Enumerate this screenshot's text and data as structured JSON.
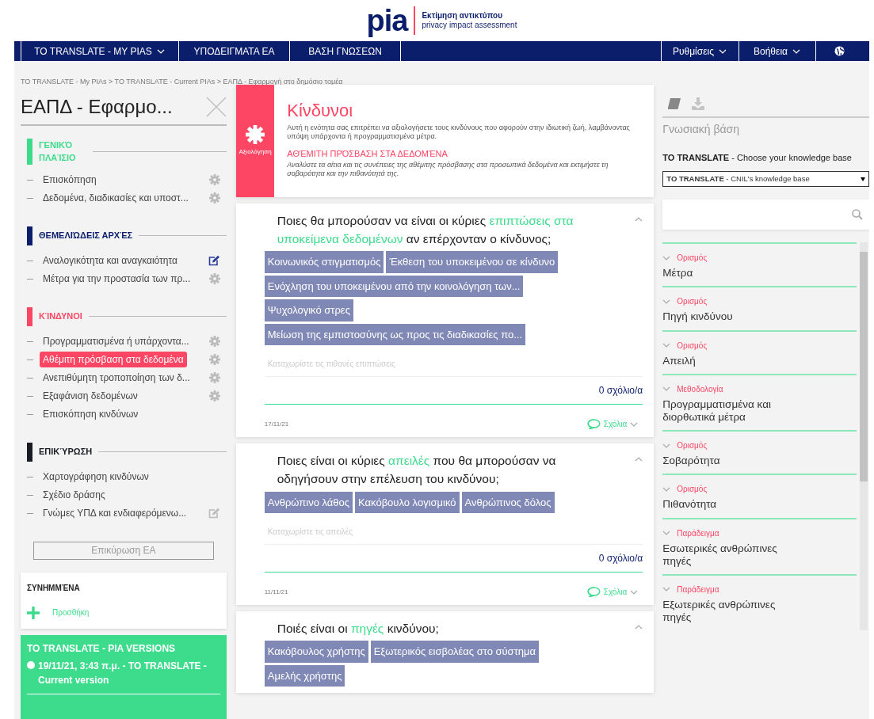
{
  "header": {
    "logo_mark": "pia",
    "logo_line1": "Εκτίμηση αντικτύπου",
    "logo_line2": "privacy impact assessment"
  },
  "nav": {
    "left": [
      {
        "label": "TO TRANSLATE - MY PIAS",
        "dropdown": true
      },
      {
        "label": "ΥΠΟΔΕΙΓΜΑΤΑ ΕΑ",
        "dropdown": false
      },
      {
        "label": "ΒΑΣΗ ΓΝΩΣΕΩΝ",
        "dropdown": false
      }
    ],
    "right": [
      {
        "label": "Ρυθμίσεις",
        "dropdown": true
      },
      {
        "label": "Βοήθεια",
        "dropdown": true
      }
    ]
  },
  "breadcrumb": "TO TRANSLATE - My PIAs > TO TRANSLATE - Current PIAs > ΕΑΠΔ - Εφαρμογή στο δημόσιο τομέα",
  "sidebar": {
    "title": "ΕΑΠΔ - Εφαρμο...",
    "sections": [
      {
        "title": "ΓΕΝΙΚΌ ΠΛΑΊΣΙΟ",
        "color": "#3ddc8c",
        "items": [
          {
            "label": "Επισκόπηση",
            "kind": "settings",
            "selected": false
          },
          {
            "label": "Δεδομένα, διαδικασίες και υποστ...",
            "kind": "settings",
            "selected": false
          }
        ]
      },
      {
        "title": "ΘΕΜΕΛΙΏΔΕΙΣ ΑΡΧΈΣ",
        "color": "#0b1e6b",
        "items": [
          {
            "label": "Αναλογικότητα και αναγκαιότητα",
            "kind": "edit",
            "active": true,
            "selected": false
          },
          {
            "label": "Μέτρα για την προστασία των πρ...",
            "kind": "settings",
            "selected": false
          }
        ]
      },
      {
        "title": "ΚΊΝΔΥΝΟΙ",
        "color": "#fd4664",
        "items": [
          {
            "label": "Προγραμματισμένα ή υπάρχοντα...",
            "kind": "settings",
            "selected": false
          },
          {
            "label": "Αθέμιτη πρόσβαση στα δεδομένα",
            "kind": "settings",
            "selected": true
          },
          {
            "label": "Ανεπιθύμητη τροποποίηση των δ...",
            "kind": "settings",
            "selected": false
          },
          {
            "label": "Εξαφάνιση δεδομένων",
            "kind": "settings",
            "selected": false
          },
          {
            "label": "Επισκόπηση κινδύνων",
            "kind": "plain",
            "selected": false
          }
        ]
      },
      {
        "title": "ΕΠΙΚΎΡΩΣΗ",
        "color": "#1a1c24",
        "items": [
          {
            "label": "Χαρτογράφηση κινδύνων",
            "kind": "plain",
            "selected": false
          },
          {
            "label": "Σχέδιο δράσης",
            "kind": "plain",
            "selected": false
          },
          {
            "label": "Γνώμες ΥΠΔ και ενδιαφερόμενω...",
            "kind": "edit",
            "active": false,
            "selected": false
          }
        ]
      }
    ],
    "validate_button": {
      "label": "Επικύρωση ΕΑ",
      "disabled": true
    },
    "attachments": {
      "title": "ΣΥΝΗΜΜΈΝΑ",
      "add_label": "Προσθήκη"
    },
    "versions": {
      "title": "TO TRANSLATE - PIA VERSIONS",
      "entries": [
        "19/11/21, 3:43 π.μ. - TO TRANSLATE - Current version"
      ]
    }
  },
  "section_header": {
    "badge_label": "Αξιολόγηση",
    "title": "Κίνδυνοι",
    "description": "Αυτή η ενότητα σας επιτρέπει να αξιολογήσετε τους κινδύνους που αφορούν στην ιδιωτική ζωή, λαμβάνοντας υπόψη υπάρχοντα ή προγραμματισμένα μέτρα.",
    "subtitle": "ΑΘΈΜΙΤΗ ΠΡΌΣΒΑΣΗ ΣΤΑ ΔΕΔΟΜΈΝΑ",
    "subdescription": "Αναλύστε τα αίτια και τις συνέπειες της αθέμιτης πρόσβασης στα προσωπικά δεδομένα και εκτιμήστε τη σοβαρότητα και την πιθανότητά της."
  },
  "questions": [
    {
      "parts": [
        {
          "text": "Ποιες θα μπορούσαν να είναι οι κύριες ",
          "highlight": false
        },
        {
          "text": "επιπτώσεις στα υποκείμενα δεδομένων",
          "highlight": true
        },
        {
          "text": " αν επέρχονταν ο κίνδυνος;",
          "highlight": false
        }
      ],
      "tags": [
        "Κοινωνικός στιγματισμός",
        "Έκθεση του υποκειμένου σε κίνδυνο",
        "Ενόχληση του υποκειμένου από την κοινολόγηση των...",
        "Ψυχολογικό στρες",
        "Μείωση της εμπιστοσύνης ως προς τις διαδικασίες πο..."
      ],
      "placeholder": "Καταχωρίστε τις πιθανές επιπτώσεις",
      "comment_count": "0 σχόλιο/α",
      "date": "17/11/21",
      "comments_label": "Σχόλια"
    },
    {
      "parts": [
        {
          "text": "Ποιες είναι οι κύριες ",
          "highlight": false
        },
        {
          "text": "απειλές",
          "highlight": true
        },
        {
          "text": " που θα μπορούσαν να οδηγήσουν στην επέλευση του κινδύνου;",
          "highlight": false
        }
      ],
      "tags": [
        "Ανθρώπινο λάθος",
        "Κακόβουλο λογισμικό",
        "Ανθρώπινος δόλος"
      ],
      "placeholder": "Καταχωρίστε τις απειλές",
      "comment_count": "0 σχόλιο/α",
      "date": "11/11/21",
      "comments_label": "Σχόλια"
    },
    {
      "parts": [
        {
          "text": "Ποιές είναι οι ",
          "highlight": false
        },
        {
          "text": "πηγές",
          "highlight": true
        },
        {
          "text": " κινδύνου;",
          "highlight": false
        }
      ],
      "tags": [
        "Κακόβουλος χρήστης",
        "Εξωτερικός εισβολέας στο σύστημα",
        "Αμελής χρήστης"
      ]
    }
  ],
  "knowledge": {
    "tabs": [
      {
        "kind": "book",
        "selected": true
      },
      {
        "kind": "download",
        "selected": false
      }
    ],
    "title": "Γνωσιακή βάση",
    "choose_label": "**TO TRANSLATE** - Choose your knowledge base",
    "select_value": "**TO TRANSLATE** - CNIL's knowledge base",
    "items": [
      {
        "category": "Ορισμός",
        "title": "Μέτρα"
      },
      {
        "category": "Ορισμός",
        "title": "Πηγή κινδύνου"
      },
      {
        "category": "Ορισμός",
        "title": "Απειλή"
      },
      {
        "category": "Μεθοδολογία",
        "title": "Προγραμματισμένα και διορθωτικά μέτρα"
      },
      {
        "category": "Ορισμός",
        "title": "Σοβαρότητα"
      },
      {
        "category": "Ορισμός",
        "title": "Πιθανότητα"
      },
      {
        "category": "Παράδειγμα",
        "title": "Εσωτερικές ανθρώπινες πηγές"
      },
      {
        "category": "Παράδειγμα",
        "title": "Εξωτερικές ανθρώπινες πηγές"
      }
    ]
  }
}
